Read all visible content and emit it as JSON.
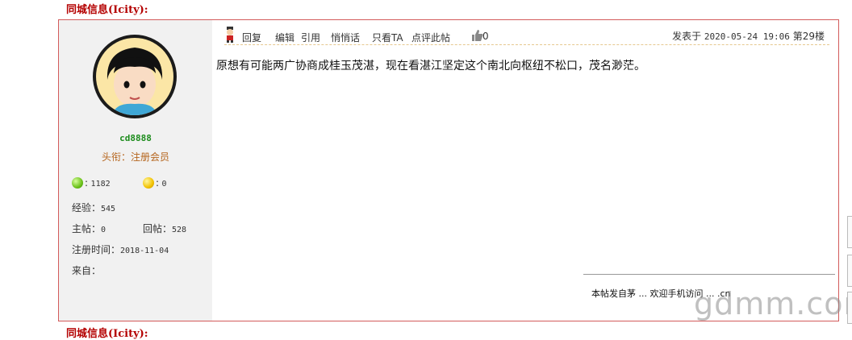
{
  "section_title": "同城信息(Icity):",
  "post": {
    "user": {
      "name": "cd8888",
      "rank": "头衔：注册会员",
      "coins_green": "1182",
      "coins_gold": "0",
      "exp_label": "经验：",
      "exp": "545",
      "topics_label": "主帖：",
      "topics": "0",
      "replies_label": "回帖：",
      "replies": "528",
      "reg_label": "注册时间：",
      "reg_date": "2018-11-04",
      "from_label": "来自："
    },
    "toolbar": {
      "reply": "回复",
      "edit": "编辑",
      "quote": "引用",
      "whisper": "悄悄话",
      "only_ta": "只看TA",
      "comment": "点评此帖",
      "likes": "0",
      "posted_prefix": "发表于 ",
      "posted_time": "2020-05-24 19:06",
      "floor": "第29楼"
    },
    "content": "原想有可能两广协商成桂玉茂湛，现在看湛江坚定这个南北向枢纽不松口，茂名渺茫。",
    "signature": "本帖发自茅 ... 欢迎手机访问 ... .cn",
    "watermark": "gdmm.com"
  },
  "colors": {
    "title": "#b40000",
    "border": "#d35b5b",
    "username": "#1c8c1c",
    "rank": "#b5651d"
  }
}
